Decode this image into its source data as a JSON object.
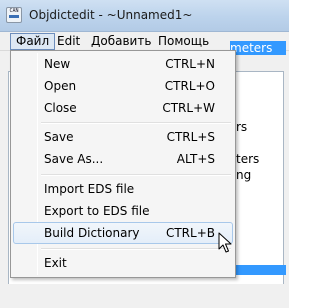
{
  "window": {
    "title": "Objdictedit - ~Unnamed1~",
    "icon": "can-app-icon",
    "icon_text": "CAN"
  },
  "menubar": {
    "items": [
      {
        "label": "Файл",
        "open": true
      },
      {
        "label": "Edit",
        "open": false
      },
      {
        "label": "Добавить",
        "open": false
      },
      {
        "label": "Помощь",
        "open": false
      }
    ]
  },
  "background": {
    "highlight_text": "meters",
    "fragments": [
      "rs",
      "ters",
      "ng"
    ]
  },
  "file_menu": {
    "items": [
      {
        "label": "New",
        "accel": "CTRL+N"
      },
      {
        "label": "Open",
        "accel": "CTRL+O"
      },
      {
        "label": "Close",
        "accel": "CTRL+W"
      },
      {
        "label": "Save",
        "accel": "CTRL+S"
      },
      {
        "label": "Save As...",
        "accel": "ALT+S"
      },
      {
        "label": "Import EDS file",
        "accel": ""
      },
      {
        "label": "Export to EDS file",
        "accel": ""
      },
      {
        "label": "Build Dictionary",
        "accel": "CTRL+B",
        "hovered": true
      },
      {
        "label": "Exit",
        "accel": ""
      }
    ]
  },
  "colors": {
    "selection": "#3399ff",
    "menu_hover_border": "#a8c8ea",
    "titlebar": "#bcd3ec"
  }
}
